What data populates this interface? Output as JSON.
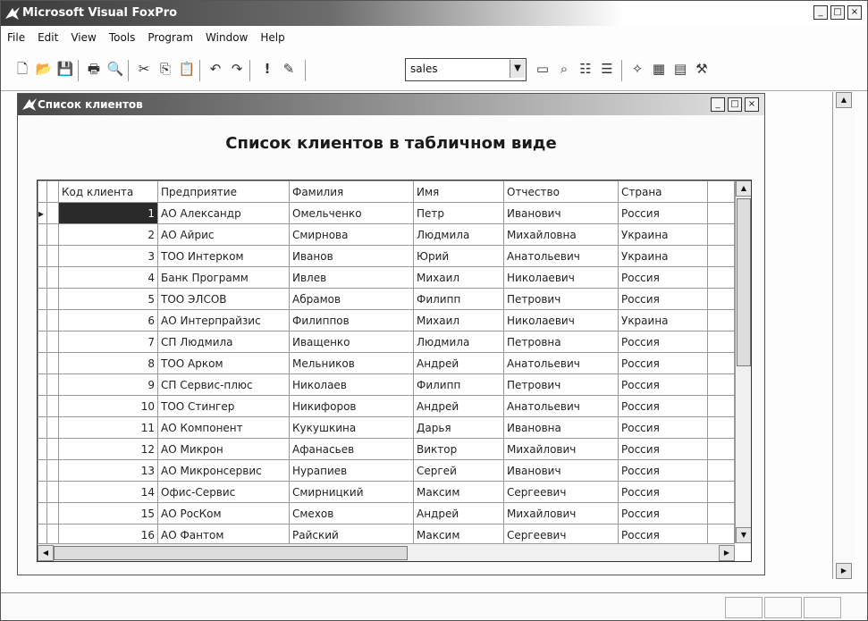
{
  "app": {
    "title": "Microsoft Visual FoxPro",
    "window_controls": [
      "_",
      "□",
      "×"
    ]
  },
  "menu": [
    "File",
    "Edit",
    "View",
    "Tools",
    "Program",
    "Window",
    "Help"
  ],
  "toolbar": {
    "icons": [
      "new-icon",
      "open-icon",
      "save-icon",
      "print-icon",
      "print-preview-icon",
      "cut-icon",
      "copy-icon",
      "paste-icon",
      "undo-icon",
      "redo-icon",
      "run-icon",
      "modify-form-icon"
    ],
    "glyphs": [
      "🗋",
      "📂",
      "💾",
      "🖶",
      "🔍",
      "✂",
      "⎘",
      "📋",
      "↶",
      "↷",
      "!",
      "✎"
    ],
    "database_combo_value": "sales",
    "right_icons": [
      "command-window-icon",
      "data-session-icon",
      "form-wizard-icon",
      "report-wizard-icon",
      "autoform-icon",
      "autoreport-icon",
      "table-icon",
      "builder-icon"
    ],
    "right_glyphs": [
      "▭",
      "⌕",
      "☷",
      "☰",
      "✧",
      "▦",
      "▤",
      "⚒"
    ]
  },
  "form": {
    "title": "Список клиентов",
    "caption": "Список клиентов в табличном виде"
  },
  "grid": {
    "columns": [
      "Код клиента",
      "Предприятие",
      "Фамилия",
      "Имя",
      "Отчество",
      "Страна"
    ],
    "rows": [
      [
        "1",
        "АО Александр",
        "Омельченко",
        "Петр",
        "Иванович",
        "Россия"
      ],
      [
        "2",
        "АО Айрис",
        "Смирнова",
        "Людмила",
        "Михайловна",
        "Украина"
      ],
      [
        "3",
        "ТОО Интерком",
        "Иванов",
        "Юрий",
        "Анатольевич",
        "Украина"
      ],
      [
        "4",
        "Банк Программ",
        "Ивлев",
        "Михаил",
        "Николаевич",
        "Россия"
      ],
      [
        "5",
        "ТОО ЭЛСОВ",
        "Абрамов",
        "Филипп",
        "Петрович",
        "Россия"
      ],
      [
        "6",
        "АО Интерпрайзис",
        "Филиппов",
        "Михаил",
        "Николаевич",
        "Украина"
      ],
      [
        "7",
        "СП Людмила",
        "Иващенко",
        "Людмила",
        "Петровна",
        "Россия"
      ],
      [
        "8",
        "ТОО Арком",
        "Мельников",
        "Андрей",
        "Анатольевич",
        "Россия"
      ],
      [
        "9",
        "СП Сервис-плюс",
        "Николаев",
        "Филипп",
        "Петрович",
        "Россия"
      ],
      [
        "10",
        "ТОО Стингер",
        "Никифоров",
        "Андрей",
        "Анатольевич",
        "Россия"
      ],
      [
        "11",
        "АО Компонент",
        "Кукушкина",
        "Дарья",
        "Ивановна",
        "Россия"
      ],
      [
        "12",
        "АО Микрон",
        "Афанасьев",
        "Виктор",
        "Михайлович",
        "Россия"
      ],
      [
        "13",
        "АО Микронсервис",
        "Нурапиев",
        "Сергей",
        "Иванович",
        "Россия"
      ],
      [
        "14",
        "Офис-Сервис",
        "Смирницкий",
        "Максим",
        "Сергеевич",
        "Россия"
      ],
      [
        "15",
        "АО РосКом",
        "Смехов",
        "Андрей",
        "Михайлович",
        "Россия"
      ],
      [
        "16",
        "АО Фантом",
        "Райский",
        "Максим",
        "Сергеевич",
        "Россия"
      ]
    ],
    "current_row": 0
  }
}
